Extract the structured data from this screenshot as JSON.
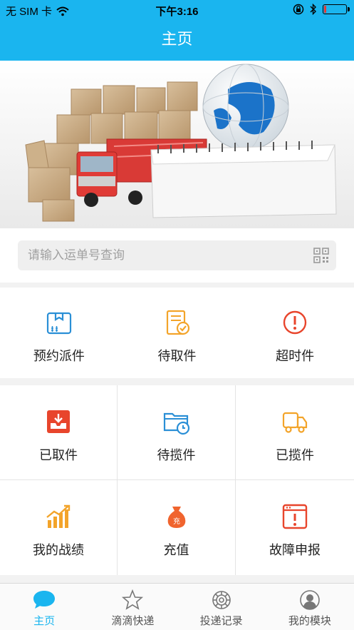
{
  "status_bar": {
    "carrier": "无 SIM 卡",
    "time": "下午3:16",
    "battery_level": 0.1,
    "icons": [
      "wifi-icon",
      "orientation-lock-icon",
      "bluetooth-icon",
      "battery-icon"
    ]
  },
  "navbar": {
    "title": "主页"
  },
  "banner": {
    "image": "logistics-banner: cardboard boxes, red truck, globe, calendar"
  },
  "search": {
    "placeholder": "请输入运单号查询",
    "value": "",
    "icon": "qr-code-icon"
  },
  "quick_actions": [
    {
      "label": "预约派件",
      "icon": "package-box-icon",
      "color": "#2a8fd6"
    },
    {
      "label": "待取件",
      "icon": "document-check-icon",
      "color": "#f3a42a"
    },
    {
      "label": "超时件",
      "icon": "alert-circle-icon",
      "color": "#e8452c"
    }
  ],
  "grid": [
    {
      "label": "已取件",
      "icon": "inbox-download-icon",
      "color": "#e8452c"
    },
    {
      "label": "待揽件",
      "icon": "folder-clock-icon",
      "color": "#2a8fd6"
    },
    {
      "label": "已揽件",
      "icon": "delivery-truck-icon",
      "color": "#f3a42a"
    },
    {
      "label": "我的战绩",
      "icon": "bar-chart-up-icon",
      "color": "#f3a42a"
    },
    {
      "label": "充值",
      "icon": "money-bag-icon",
      "color": "#f0642e"
    },
    {
      "label": "故障申报",
      "icon": "alert-window-icon",
      "color": "#e8452c"
    }
  ],
  "tabbar": {
    "active_color": "#1ab5ef",
    "items": [
      {
        "label": "主页",
        "icon": "chat-bubble-icon",
        "active": true
      },
      {
        "label": "滴滴快递",
        "icon": "star-icon",
        "active": false
      },
      {
        "label": "投递记录",
        "icon": "gear-icon",
        "active": false
      },
      {
        "label": "我的模块",
        "icon": "user-icon",
        "active": false
      }
    ]
  },
  "colors": {
    "brand": "#1ab5ef",
    "page_bg": "#f2f2f2"
  }
}
